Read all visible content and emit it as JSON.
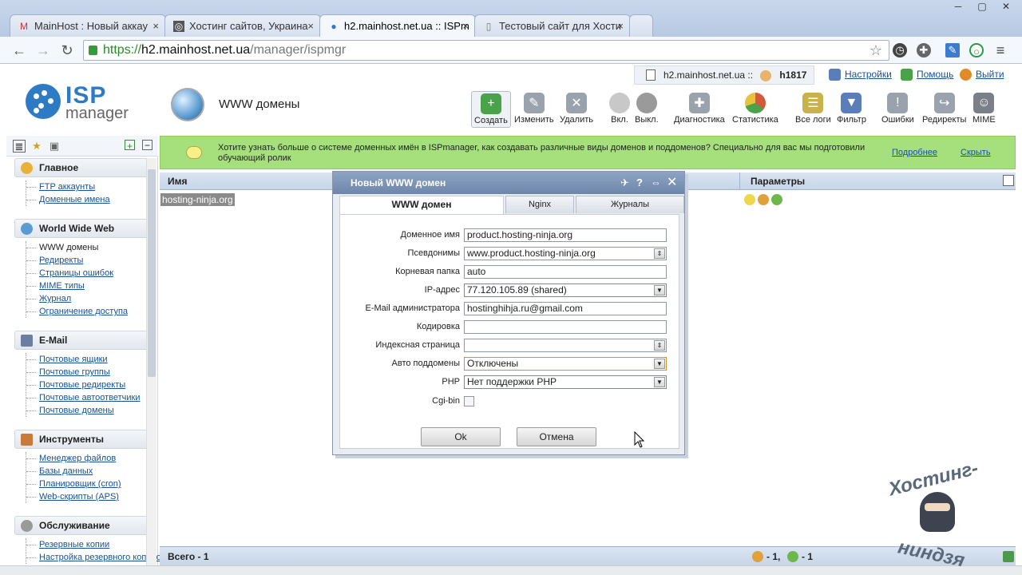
{
  "browser": {
    "tabs": [
      {
        "title": "MainHost : Новый аккау",
        "icon": "gmail-icon"
      },
      {
        "title": "Хостинг сайтов, Украина",
        "icon": "site-icon"
      },
      {
        "title": "h2.mainhost.net.ua :: ISPm",
        "icon": "ispmanager-icon"
      },
      {
        "title": "Тестовый сайт для Хости",
        "icon": "page-icon"
      }
    ],
    "url_scheme": "https://",
    "url_host": "h2.mainhost.net.ua",
    "url_path": "/manager/ispmgr"
  },
  "header": {
    "logo_top": "ISP",
    "logo_bottom": "manager",
    "page_title": "WWW домены",
    "server": "h2.mainhost.net.ua ::",
    "user": "h1817",
    "settings": "Настройки",
    "help": "Помощь",
    "logout": "Выйти"
  },
  "toolbar": [
    {
      "label": "Создать",
      "icon": "create-icon",
      "color": "#4aa24a"
    },
    {
      "label": "Изменить",
      "icon": "edit-icon",
      "color": "#9aa3ad"
    },
    {
      "label": "Удалить",
      "icon": "delete-icon",
      "color": "#9aa3ad"
    },
    {
      "label": "Вкл.",
      "icon": "bulb-on-icon",
      "color": "#c8c8c8"
    },
    {
      "label": "Выкл.",
      "icon": "bulb-off-icon",
      "color": "#9a9a9a"
    },
    {
      "label": "Диагностика",
      "icon": "diagnostics-icon",
      "color": "#9aa3ad"
    },
    {
      "label": "Статистика",
      "icon": "statistics-icon",
      "color": "#d05a3a"
    },
    {
      "label": "Все логи",
      "icon": "logs-icon",
      "color": "#c9b24a"
    },
    {
      "label": "Фильтр",
      "icon": "filter-icon",
      "color": "#5a7fb8"
    },
    {
      "label": "Ошибки",
      "icon": "errors-icon",
      "color": "#9aa3ad"
    },
    {
      "label": "Редиректы",
      "icon": "redirects-icon",
      "color": "#9aa3ad"
    },
    {
      "label": "MIME",
      "icon": "mime-icon",
      "color": "#7a7f88"
    }
  ],
  "sidebar": {
    "groups": [
      {
        "title": "Главное",
        "items": [
          "FTP аккаунты",
          "Доменные имена"
        ]
      },
      {
        "title": "World Wide Web",
        "items": [
          "WWW домены",
          "Редиректы",
          "Страницы ошибок",
          "MIME типы",
          "Журнал",
          "Ограничение доступа"
        ]
      },
      {
        "title": "E-Mail",
        "items": [
          "Почтовые ящики",
          "Почтовые группы",
          "Почтовые редиректы",
          "Почтовые автоответчики",
          "Почтовые домены"
        ]
      },
      {
        "title": "Инструменты",
        "items": [
          "Менеджер файлов",
          "Базы данных",
          "Планировщик (cron)",
          "Web-скрипты (APS)"
        ]
      },
      {
        "title": "Обслуживание",
        "items": [
          "Резервные копии",
          "Настройка резервного копирования"
        ]
      }
    ]
  },
  "notice": {
    "text": "Хотите узнать больше о системе доменных имён в ISPmanager, как создавать различные виды доменов и поддоменов? Специально для вас мы подготовили обучающий ролик",
    "more": "Подробнее",
    "hide": "Скрыть"
  },
  "list": {
    "col_name": "Имя",
    "col_params": "Параметры",
    "rows": [
      {
        "name": "hosting-ninja.org"
      }
    ],
    "footer_total": "Всего - 1",
    "footer_cgi": "- 1,",
    "footer_php": "- 1"
  },
  "dialog": {
    "title": "Новый WWW домен",
    "tabs": [
      "WWW домен",
      "Nginx",
      "Журналы"
    ],
    "fields": [
      {
        "label": "Доменное имя",
        "value": "product.hosting-ninja.org",
        "type": "text"
      },
      {
        "label": "Псевдонимы",
        "value": "www.product.hosting-ninja.org",
        "type": "spin"
      },
      {
        "label": "Корневая папка",
        "value": "auto",
        "type": "text"
      },
      {
        "label": "IP-адрес",
        "value": "77.120.105.89 (shared)",
        "type": "select"
      },
      {
        "label": "E-Mail администратора",
        "value": "hostinghihja.ru@gmail.com",
        "type": "text"
      },
      {
        "label": "Кодировка",
        "value": "",
        "type": "text"
      },
      {
        "label": "Индексная страница",
        "value": "",
        "type": "spin"
      },
      {
        "label": "Авто поддомены",
        "value": "Отключены",
        "type": "select"
      },
      {
        "label": "PHP",
        "value": "Нет поддержки PHP",
        "type": "select"
      },
      {
        "label": "Cgi-bin",
        "value": "",
        "type": "checkbox"
      }
    ],
    "ok": "Ok",
    "cancel": "Отмена"
  },
  "watermark": {
    "top": "Хостинг-",
    "bottom": "ниндзя"
  }
}
